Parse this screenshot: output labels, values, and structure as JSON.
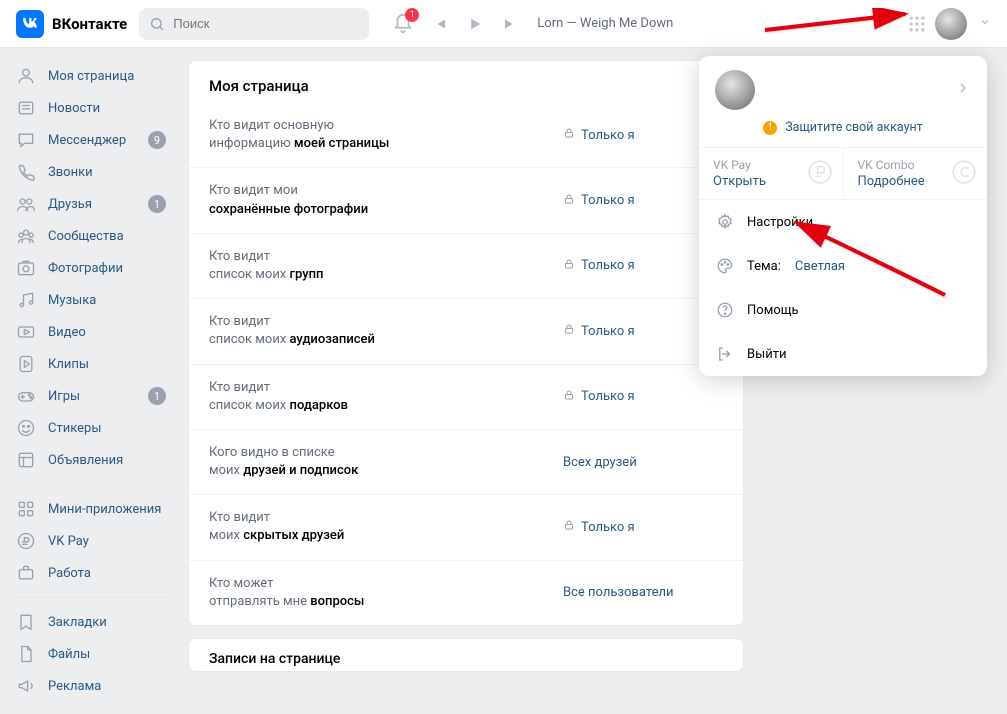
{
  "header": {
    "brand": "ВКонтакте",
    "search_placeholder": "Поиск",
    "notif_count": "1",
    "track": "Lorn — Weigh Me Down"
  },
  "sidebar": {
    "items": [
      {
        "label": "Моя страница",
        "icon": "home-icon",
        "badge": ""
      },
      {
        "label": "Новости",
        "icon": "news-icon",
        "badge": ""
      },
      {
        "label": "Мессенджер",
        "icon": "chat-icon",
        "badge": "9"
      },
      {
        "label": "Звонки",
        "icon": "phone-icon",
        "badge": ""
      },
      {
        "label": "Друзья",
        "icon": "friends-icon",
        "badge": "1"
      },
      {
        "label": "Сообщества",
        "icon": "groups-icon",
        "badge": ""
      },
      {
        "label": "Фотографии",
        "icon": "photo-icon",
        "badge": ""
      },
      {
        "label": "Музыка",
        "icon": "music-icon",
        "badge": ""
      },
      {
        "label": "Видео",
        "icon": "video-icon",
        "badge": ""
      },
      {
        "label": "Клипы",
        "icon": "clips-icon",
        "badge": ""
      },
      {
        "label": "Игры",
        "icon": "games-icon",
        "badge": "1"
      },
      {
        "label": "Стикеры",
        "icon": "sticker-icon",
        "badge": ""
      },
      {
        "label": "Объявления",
        "icon": "ads-icon",
        "badge": ""
      }
    ],
    "items2": [
      {
        "label": "Мини-приложения",
        "icon": "apps-icon"
      },
      {
        "label": "VK Pay",
        "icon": "pay-icon"
      },
      {
        "label": "Работа",
        "icon": "work-icon"
      }
    ],
    "items3": [
      {
        "label": "Закладки",
        "icon": "bookmark-icon"
      },
      {
        "label": "Файлы",
        "icon": "files-icon"
      },
      {
        "label": "Реклама",
        "icon": "adv-icon"
      }
    ]
  },
  "main": {
    "title": "Моя страница",
    "rows": [
      {
        "l1": "Кто видит основную",
        "l2": "информацию ",
        "lb": "моей страницы",
        "value": "Только я",
        "lock": true
      },
      {
        "l1": "Кто видит мои",
        "l2": "",
        "lb": "сохранённые фотографии",
        "value": "Только я",
        "lock": true
      },
      {
        "l1": "Кто видит",
        "l2": "список моих ",
        "lb": "групп",
        "value": "Только я",
        "lock": true
      },
      {
        "l1": "Кто видит",
        "l2": "список моих ",
        "lb": "аудиозаписей",
        "value": "Только я",
        "lock": true
      },
      {
        "l1": "Кто видит",
        "l2": "список моих ",
        "lb": "подарков",
        "value": "Только я",
        "lock": true
      },
      {
        "l1": "Кого видно в списке",
        "l2": "моих ",
        "lb": "друзей и подписок",
        "value": "Всех друзей",
        "lock": false
      },
      {
        "l1": "Кто видит",
        "l2": "моих ",
        "lb": "скрытых друзей",
        "value": "Только я",
        "lock": true
      },
      {
        "l1": "Кто может",
        "l2": "отправлять мне ",
        "lb": "вопросы",
        "value": "Все пользователи",
        "lock": false
      }
    ],
    "section2": "Записи на странице"
  },
  "dropdown": {
    "protect": "Защитите свой аккаунт",
    "pay": {
      "title": "VK Pay",
      "action": "Открыть"
    },
    "combo": {
      "title": "VK Combo",
      "action": "Подробнее"
    },
    "settings": "Настройки",
    "theme_label": "Тема:",
    "theme_value": "Светлая",
    "help": "Помощь",
    "logout": "Выйти"
  }
}
